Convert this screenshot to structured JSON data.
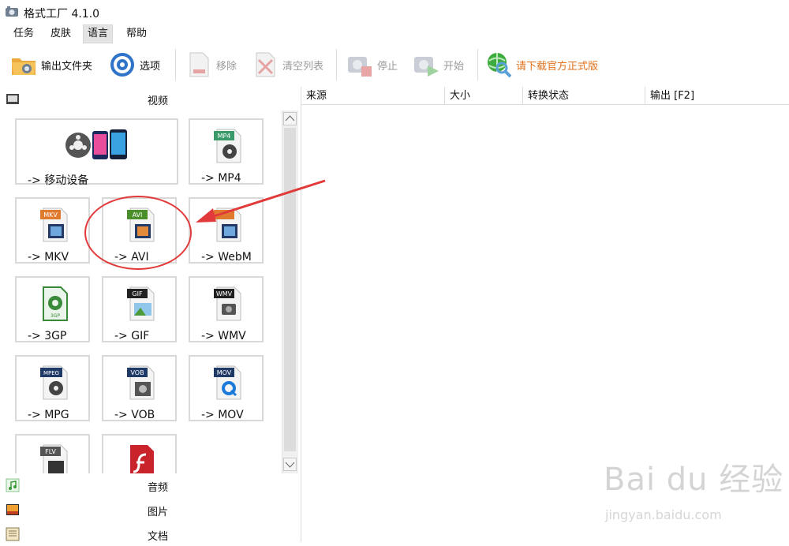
{
  "window": {
    "title": "格式工厂 4.1.0"
  },
  "menu": {
    "items": [
      "任务",
      "皮肤",
      "语言",
      "帮助"
    ],
    "active": "语言"
  },
  "toolbar": {
    "output_folder": "输出文件夹",
    "options": "选项",
    "remove": "移除",
    "clear_list": "清空列表",
    "stop": "停止",
    "start": "开始",
    "download": "请下载官方正式版"
  },
  "categories": {
    "video": "视频",
    "audio": "音频",
    "image": "图片",
    "document": "文档"
  },
  "video_tiles": [
    {
      "label": "-> 移动设备",
      "icon": "mobile-device-icon"
    },
    {
      "label": "-> MP4",
      "icon": "mp4-file-icon",
      "tag": "MP4"
    },
    {
      "label": "-> MKV",
      "icon": "mkv-file-icon",
      "tag": "MKV"
    },
    {
      "label": "-> AVI",
      "icon": "avi-file-icon",
      "tag": "AVI"
    },
    {
      "label": "-> WebM",
      "icon": "webm-file-icon",
      "tag": "WebM"
    },
    {
      "label": "-> 3GP",
      "icon": "3gp-file-icon",
      "tag": "3GP"
    },
    {
      "label": "-> GIF",
      "icon": "gif-file-icon",
      "tag": "GIF"
    },
    {
      "label": "-> WMV",
      "icon": "wmv-file-icon",
      "tag": "WMV"
    },
    {
      "label": "-> MPG",
      "icon": "mpg-file-icon",
      "tag": "MPEG"
    },
    {
      "label": "-> VOB",
      "icon": "vob-file-icon",
      "tag": "VOB"
    },
    {
      "label": "-> MOV",
      "icon": "mov-file-icon",
      "tag": "MOV"
    },
    {
      "label": "",
      "icon": "flv-file-icon",
      "tag": "FLV"
    },
    {
      "label": "",
      "icon": "swf-file-icon"
    }
  ],
  "table": {
    "columns": [
      "来源",
      "大小",
      "转换状态",
      "输出 [F2]"
    ]
  },
  "watermark": {
    "main": "Bai du 经验",
    "sub": "jingyan.baidu.com"
  },
  "colors": {
    "accent_orange": "#e0701a",
    "annotation_red": "#e23a3a"
  }
}
